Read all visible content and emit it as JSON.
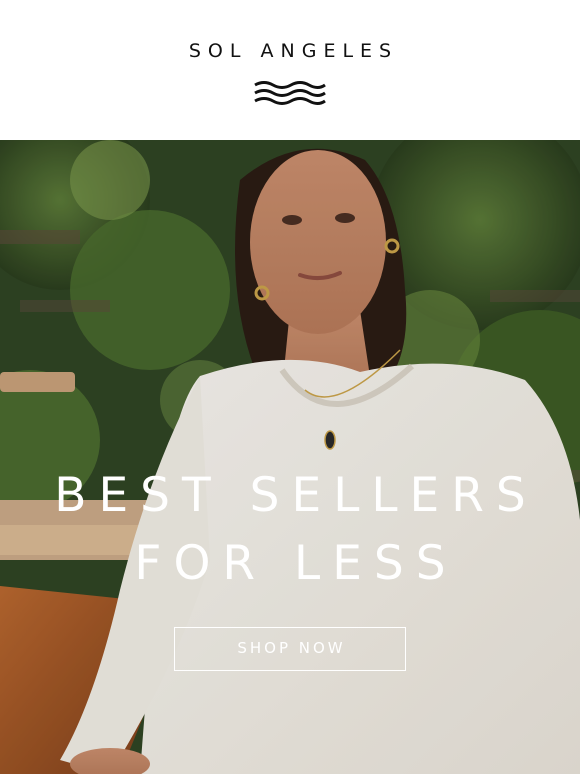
{
  "header": {
    "brand": "SOL ANGELES",
    "logo_icon": "waves-icon"
  },
  "hero": {
    "headline_line1": "BEST SELLERS",
    "headline_line2": "FOR LESS",
    "cta_label": "SHOP NOW"
  },
  "colors": {
    "background": "#ffffff",
    "brand_text": "#111111",
    "hero_text": "#ffffff",
    "sweater": "#f1ede6",
    "foliage": "#3c5a2a",
    "leather_chair": "#a4592a"
  }
}
